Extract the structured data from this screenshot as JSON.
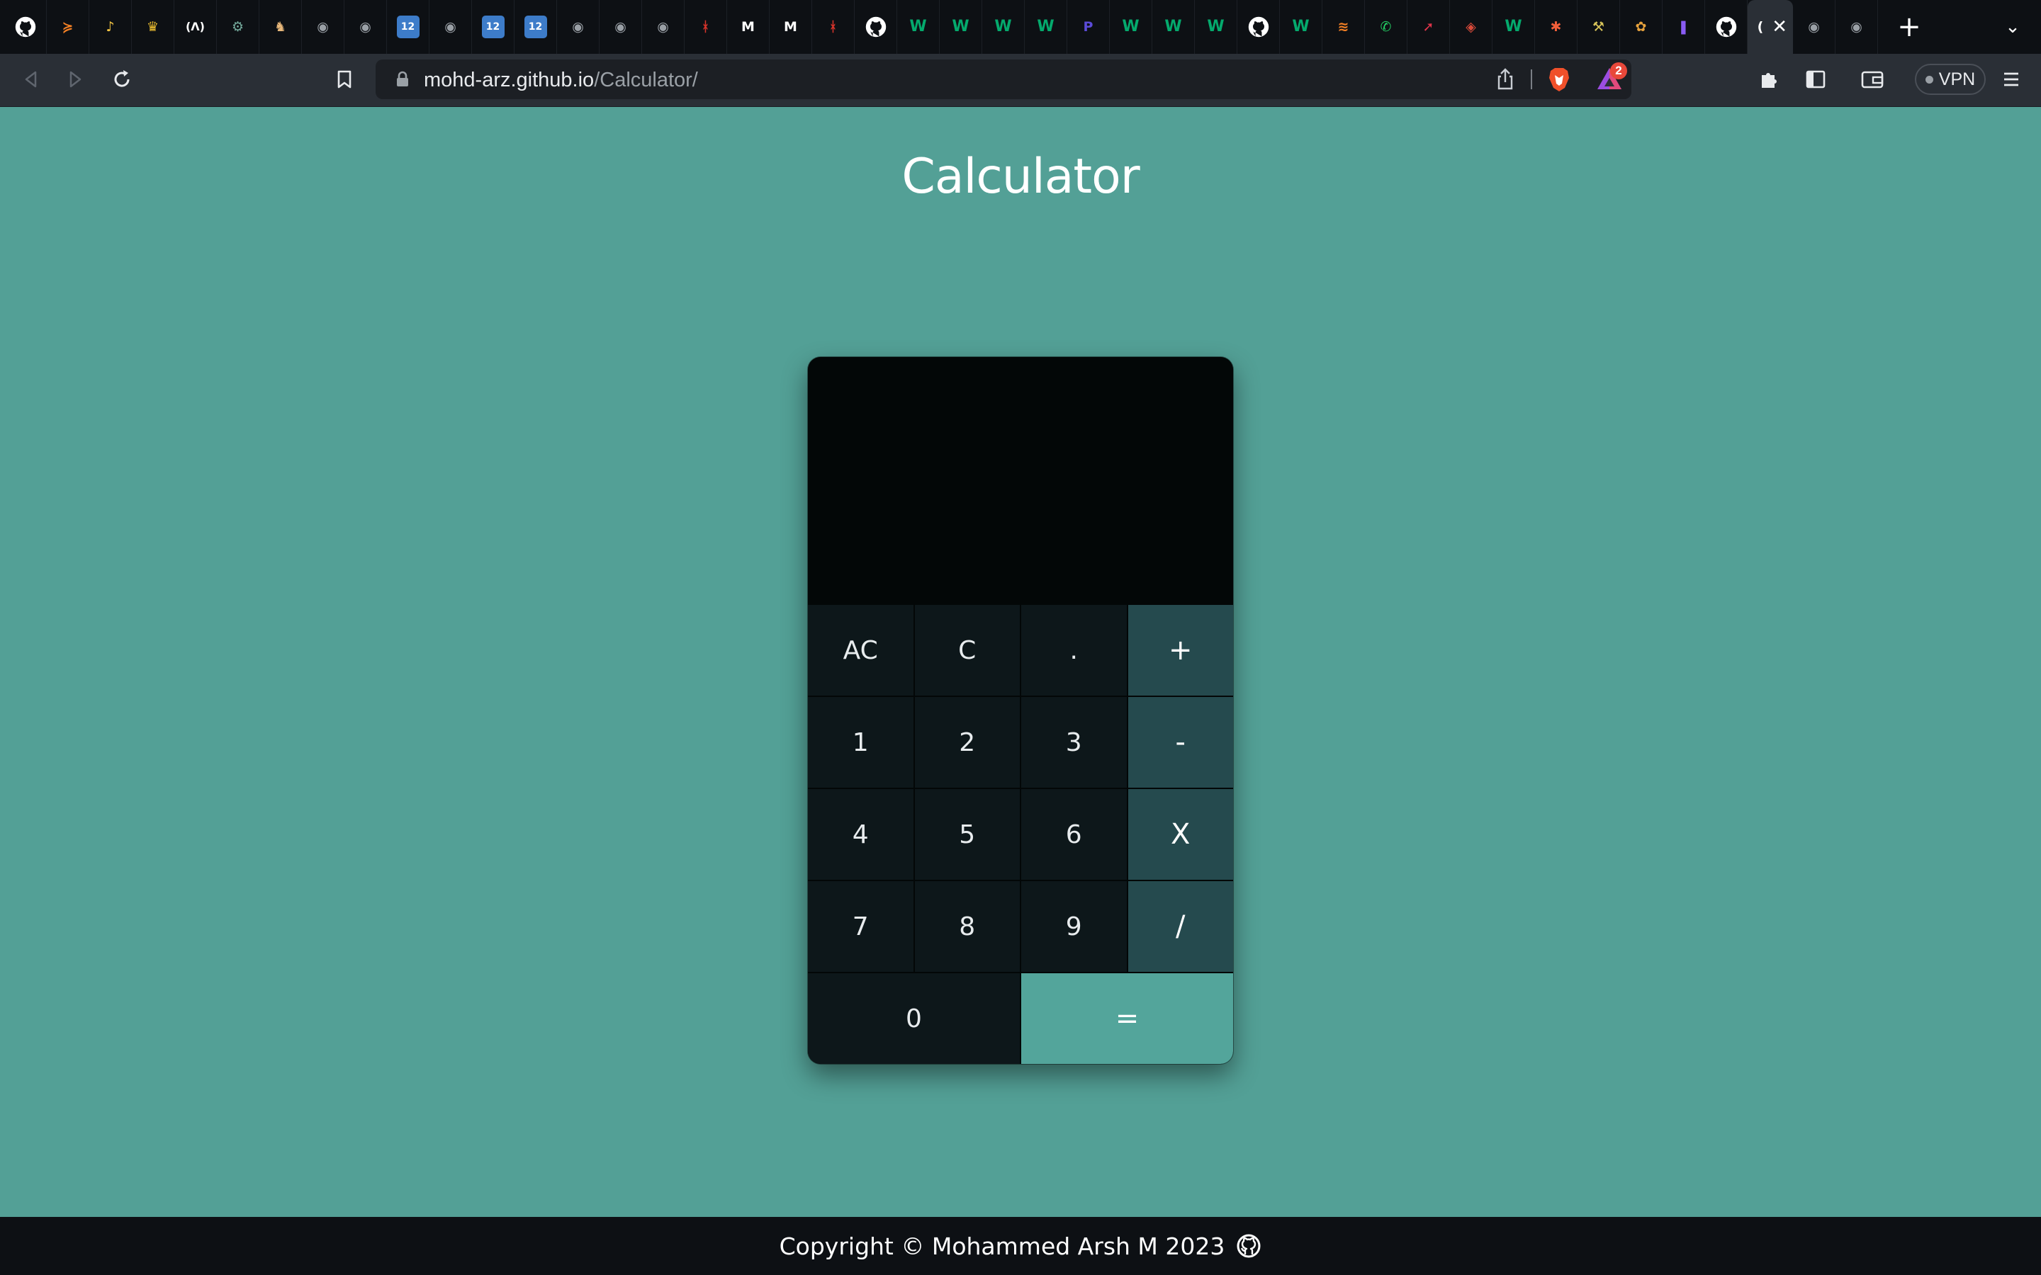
{
  "browser": {
    "tabs": [
      {
        "icon": "github-icon",
        "glyph": "",
        "color": "#ffffff"
      },
      {
        "icon": "stackoverflow-icon",
        "glyph": "≽",
        "color": "#f48024"
      },
      {
        "icon": "bell-icon",
        "glyph": "♪",
        "color": "#f4c542"
      },
      {
        "icon": "crown-icon",
        "glyph": "♛",
        "color": "#f2c230"
      },
      {
        "icon": "freecodecamp-icon",
        "glyph": "(Λ)",
        "color": "#ffffff"
      },
      {
        "icon": "openai-icon",
        "glyph": "⚙",
        "color": "#74aa9c"
      },
      {
        "icon": "viking-icon",
        "glyph": "♞",
        "color": "#e8b87a"
      },
      {
        "icon": "globe-icon",
        "glyph": "◉",
        "color": "#9aa0a6"
      },
      {
        "icon": "globe-icon",
        "glyph": "◉",
        "color": "#9aa0a6"
      },
      {
        "icon": "numbers-icon",
        "glyph": "12",
        "color": "#3d7cc9"
      },
      {
        "icon": "globe-icon",
        "glyph": "◉",
        "color": "#9aa0a6"
      },
      {
        "icon": "numbers-icon",
        "glyph": "12",
        "color": "#3d7cc9"
      },
      {
        "icon": "numbers-icon",
        "glyph": "12",
        "color": "#3d7cc9"
      },
      {
        "icon": "globe-icon",
        "glyph": "◉",
        "color": "#9aa0a6"
      },
      {
        "icon": "globe-icon",
        "glyph": "◉",
        "color": "#9aa0a6"
      },
      {
        "icon": "globe-icon",
        "glyph": "◉",
        "color": "#9aa0a6"
      },
      {
        "icon": "figure-icon",
        "glyph": "ᚼ",
        "color": "#d9342b"
      },
      {
        "icon": "m-logo-icon",
        "glyph": "M",
        "color": "#ffffff"
      },
      {
        "icon": "m-logo-icon",
        "glyph": "M",
        "color": "#ffffff"
      },
      {
        "icon": "figure-icon",
        "glyph": "ᚼ",
        "color": "#d9342b"
      },
      {
        "icon": "github-icon",
        "glyph": "",
        "color": "#ffffff"
      },
      {
        "icon": "w3schools-icon",
        "glyph": "W",
        "color": "#04aa6d"
      },
      {
        "icon": "w3schools-icon",
        "glyph": "W",
        "color": "#04aa6d"
      },
      {
        "icon": "w3schools-icon",
        "glyph": "W",
        "color": "#04aa6d"
      },
      {
        "icon": "w3schools-icon",
        "glyph": "W",
        "color": "#04aa6d"
      },
      {
        "icon": "p-logo-icon",
        "glyph": "P",
        "color": "#5b4bd8"
      },
      {
        "icon": "w3schools-icon",
        "glyph": "W",
        "color": "#04aa6d"
      },
      {
        "icon": "w3schools-icon",
        "glyph": "W",
        "color": "#04aa6d"
      },
      {
        "icon": "w3schools-icon",
        "glyph": "W",
        "color": "#04aa6d"
      },
      {
        "icon": "github-icon",
        "glyph": "",
        "color": "#ffffff"
      },
      {
        "icon": "w3schools-icon",
        "glyph": "W",
        "color": "#04aa6d"
      },
      {
        "icon": "stack-icon",
        "glyph": "≋",
        "color": "#f48024"
      },
      {
        "icon": "whatsapp-icon",
        "glyph": "✆",
        "color": "#25d366"
      },
      {
        "icon": "rocket-icon",
        "glyph": "➚",
        "color": "#e0344a"
      },
      {
        "icon": "shield-icon",
        "glyph": "◈",
        "color": "#d94a3a"
      },
      {
        "icon": "w3schools-icon",
        "glyph": "W",
        "color": "#04aa6d"
      },
      {
        "icon": "asterisk-icon",
        "glyph": "✱",
        "color": "#f25f3a"
      },
      {
        "icon": "tools-icon",
        "glyph": "⚒",
        "color": "#d8c45a"
      },
      {
        "icon": "colorful-logo-icon",
        "glyph": "✿",
        "color": "#e8a33d"
      },
      {
        "icon": "bars-logo-icon",
        "glyph": "❚",
        "color": "#8a5cf5"
      },
      {
        "icon": "github-icon",
        "glyph": "",
        "color": "#ffffff"
      }
    ],
    "active_tab_glyph": "(",
    "after_tabs": [
      {
        "icon": "globe-icon",
        "glyph": "◉",
        "color": "#9aa0a6"
      },
      {
        "icon": "globe-icon",
        "glyph": "◉",
        "color": "#9aa0a6"
      }
    ],
    "new_tab_label": "+",
    "tab_menu_label": "⌄",
    "close_label": "✕",
    "url_host": "mohd-arz.github.io",
    "url_path": "/Calculator/",
    "rewards_count": "2",
    "vpn_label": "VPN"
  },
  "page": {
    "title": "Calculator"
  },
  "calculator": {
    "display_value": "",
    "keys": [
      {
        "label": "AC",
        "name": "all-clear-button",
        "kind": "num"
      },
      {
        "label": "C",
        "name": "clear-button",
        "kind": "num"
      },
      {
        "label": ".",
        "name": "decimal-button",
        "kind": "num"
      },
      {
        "label": "+",
        "name": "add-button",
        "kind": "op"
      },
      {
        "label": "1",
        "name": "digit-1-button",
        "kind": "num"
      },
      {
        "label": "2",
        "name": "digit-2-button",
        "kind": "num"
      },
      {
        "label": "3",
        "name": "digit-3-button",
        "kind": "num"
      },
      {
        "label": "-",
        "name": "subtract-button",
        "kind": "op"
      },
      {
        "label": "4",
        "name": "digit-4-button",
        "kind": "num"
      },
      {
        "label": "5",
        "name": "digit-5-button",
        "kind": "num"
      },
      {
        "label": "6",
        "name": "digit-6-button",
        "kind": "num"
      },
      {
        "label": "X",
        "name": "multiply-button",
        "kind": "op"
      },
      {
        "label": "7",
        "name": "digit-7-button",
        "kind": "num"
      },
      {
        "label": "8",
        "name": "digit-8-button",
        "kind": "num"
      },
      {
        "label": "9",
        "name": "digit-9-button",
        "kind": "num"
      },
      {
        "label": "/",
        "name": "divide-button",
        "kind": "op"
      },
      {
        "label": "0",
        "name": "digit-0-button",
        "kind": "wide"
      },
      {
        "label": "=",
        "name": "equals-button",
        "kind": "eq"
      }
    ]
  },
  "footer": {
    "copyright": "Copyright © Mohammed Arsh M 2023"
  },
  "colors": {
    "page_bg": "#53a096",
    "operator_key": "#254a4e",
    "number_key": "#0d171a",
    "equals_key": "#53a59b",
    "display_bg": "#030707"
  }
}
